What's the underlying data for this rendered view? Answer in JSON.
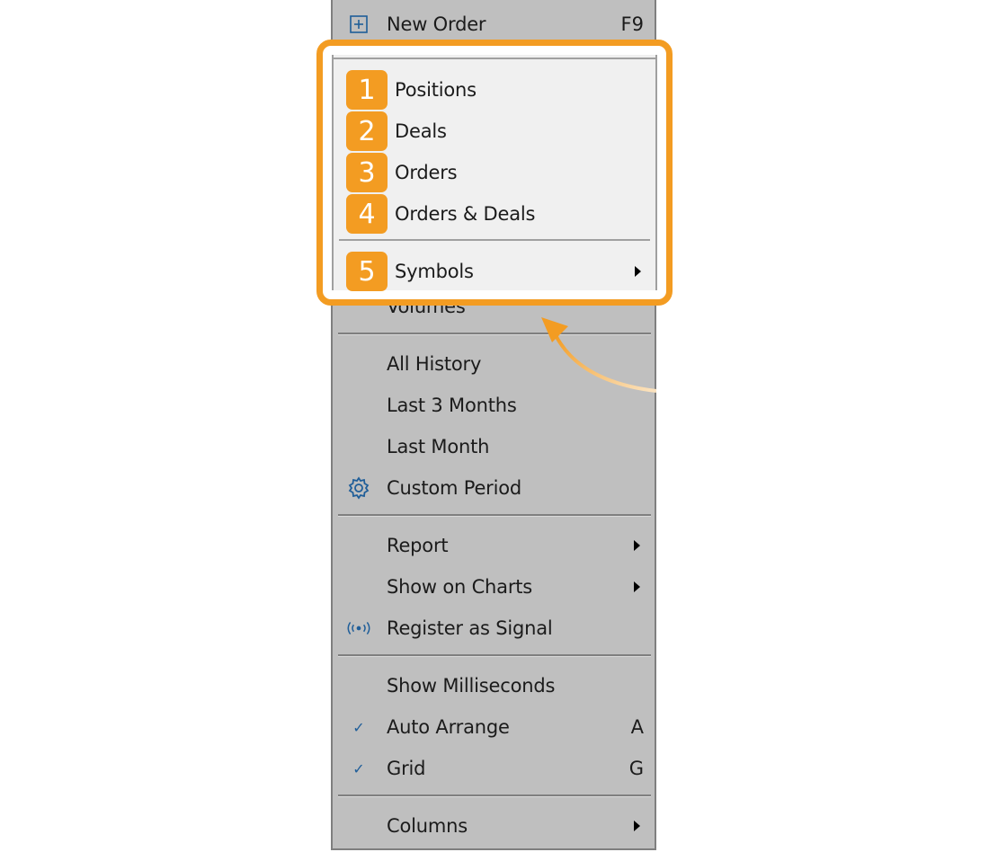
{
  "menu": {
    "top_item": {
      "label": "New Order",
      "shortcut": "F9",
      "icon": "new-order-icon"
    },
    "partial_item": {
      "label": "Volumes"
    },
    "history_items": [
      {
        "label": "All History"
      },
      {
        "label": "Last 3 Months"
      },
      {
        "label": "Last Month"
      },
      {
        "label": "Custom Period",
        "icon": "gear-icon"
      }
    ],
    "action_items": [
      {
        "label": "Report",
        "submenu": true
      },
      {
        "label": "Show on Charts",
        "submenu": true
      },
      {
        "label": "Register as Signal",
        "icon": "signal-icon"
      }
    ],
    "view_items": [
      {
        "label": "Show Milliseconds",
        "checked": false
      },
      {
        "label": "Auto Arrange",
        "checked": true,
        "shortcut": "A",
        "check": "✓"
      },
      {
        "label": "Grid",
        "checked": true,
        "shortcut": "G",
        "check": "✓"
      }
    ],
    "bottom_items": [
      {
        "label": "Columns",
        "submenu": true
      }
    ]
  },
  "highlight": {
    "accent_color": "#f39c22",
    "items": [
      {
        "number": "1",
        "label": "Positions"
      },
      {
        "number": "2",
        "label": "Deals"
      },
      {
        "number": "3",
        "label": "Orders"
      },
      {
        "number": "4",
        "label": "Orders & Deals"
      },
      {
        "number": "5",
        "label": "Symbols",
        "submenu": true
      }
    ]
  }
}
